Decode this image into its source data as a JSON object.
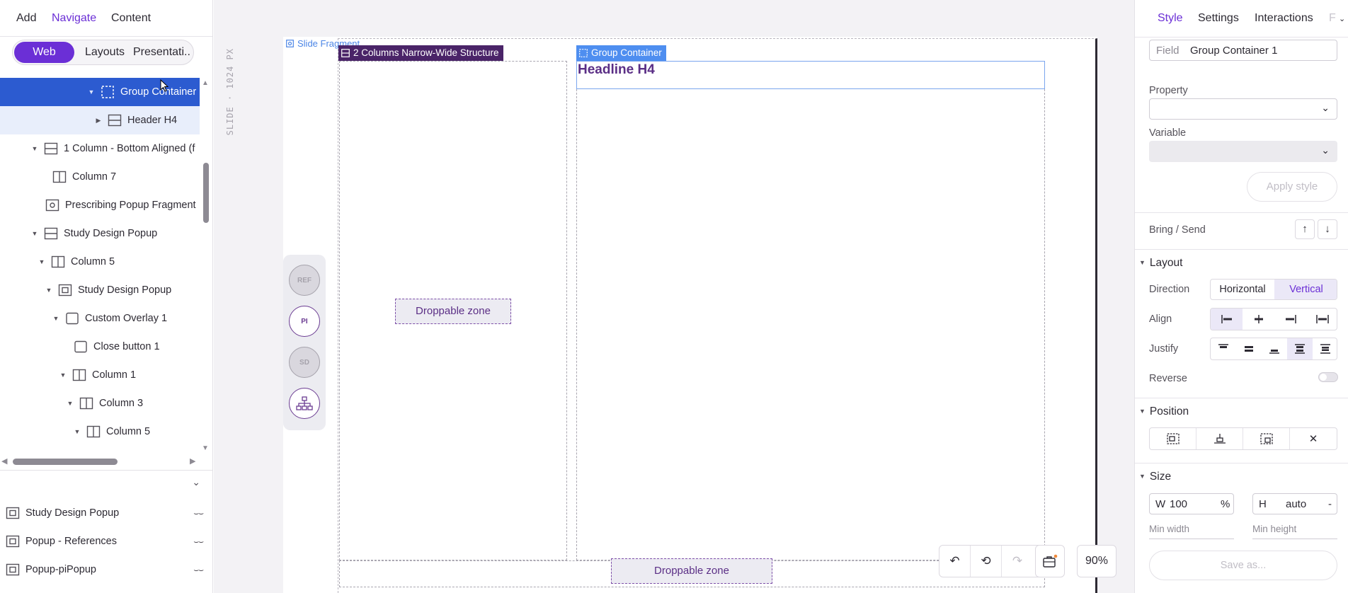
{
  "left_panel": {
    "tabs": [
      "Add",
      "Navigate",
      "Content"
    ],
    "segments": [
      "Web",
      "Layouts",
      "Presentati..."
    ],
    "tree": [
      {
        "label": "Group Container",
        "icon": "group-icon"
      },
      {
        "label": "Header H4",
        "icon": "row-layout-icon"
      },
      {
        "label": "1 Column - Bottom Aligned (f",
        "icon": "row-layout-icon"
      },
      {
        "label": "Column 7",
        "icon": "column-icon"
      },
      {
        "label": "Prescribing Popup Fragment",
        "icon": "fragment-icon"
      },
      {
        "label": "Study Design Popup",
        "icon": "row-layout-icon"
      },
      {
        "label": "Column 5",
        "icon": "column-icon"
      },
      {
        "label": "Study Design Popup",
        "icon": "popup-icon"
      },
      {
        "label": "Custom Overlay 1",
        "icon": "box-icon"
      },
      {
        "label": "Close button 1",
        "icon": "box-icon"
      },
      {
        "label": "Column 1",
        "icon": "column-icon"
      },
      {
        "label": "Column 3",
        "icon": "column-icon"
      },
      {
        "label": "Column 5",
        "icon": "column-icon"
      }
    ],
    "popups": [
      "Study Design Popup",
      "Popup - References",
      "Popup-piPopup"
    ]
  },
  "canvas": {
    "slide_label": "SLIDE · 1024 PX",
    "fragment_label": "Slide Fragment",
    "structure_tag": "2 Columns Narrow-Wide Structure",
    "group_tag": "Group Container",
    "headline": "Headline H4",
    "drop_zone_1": "Droppable zone",
    "drop_zone_2": "Droppable zone",
    "rail_buttons": [
      "REF",
      "PI",
      "SD"
    ],
    "zoom": "90%"
  },
  "right_panel": {
    "tabs": [
      "Style",
      "Settings",
      "Interactions",
      "F"
    ],
    "field_key": "Field",
    "field_value": "Group Container 1",
    "property_label": "Property",
    "variable_label": "Variable",
    "apply_style": "Apply style",
    "bring_send": "Bring / Send",
    "layout_title": "Layout",
    "direction_label": "Direction",
    "direction_options": [
      "Horizontal",
      "Vertical"
    ],
    "align_label": "Align",
    "justify_label": "Justify",
    "reverse_label": "Reverse",
    "position_title": "Position",
    "size_title": "Size",
    "width_key": "W",
    "width_value": "100",
    "width_unit": "%",
    "height_key": "H",
    "height_value": "auto",
    "height_unit": "-",
    "min_width": "Min width",
    "min_height": "Min height",
    "save_as": "Save as..."
  },
  "colors": {
    "accent": "#6b2fd6",
    "selection": "#2c5bd0",
    "structure_tag": "#4a2468",
    "group_tag": "#4e8ef0"
  }
}
